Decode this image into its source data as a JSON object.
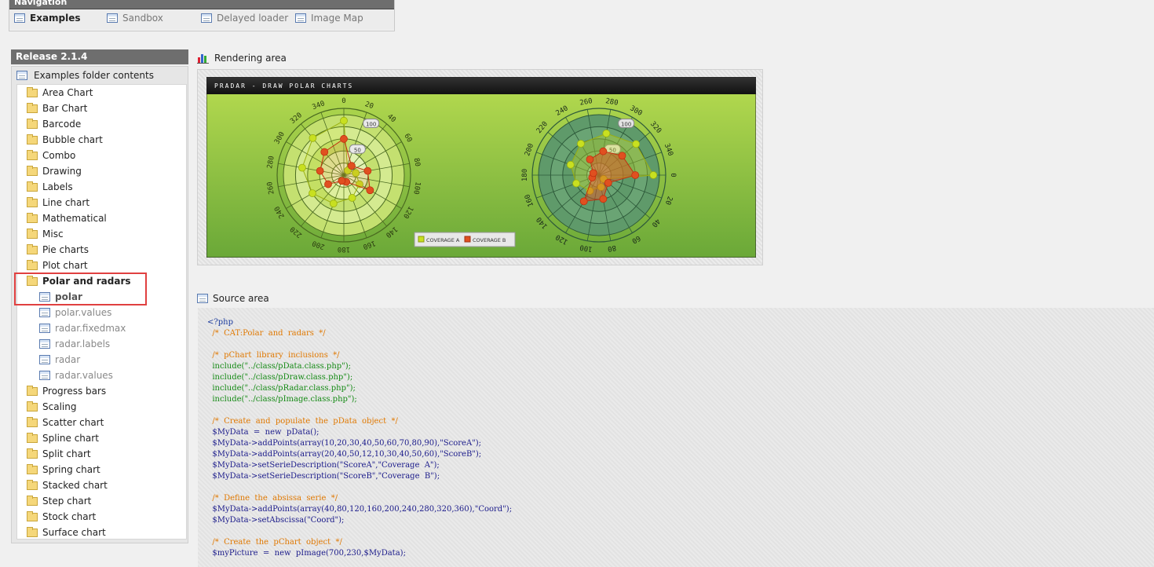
{
  "nav": {
    "title": "Navigation",
    "items": [
      {
        "label": "Examples",
        "icon": "table-icon",
        "active": true
      },
      {
        "label": "Sandbox",
        "icon": "table-icon"
      },
      {
        "label": "Delayed loader",
        "icon": "table-icon"
      },
      {
        "label": "Image Map",
        "icon": "table-icon"
      }
    ]
  },
  "release": "Release 2.1.4",
  "folder_header": "Examples folder contents",
  "tree": {
    "folders_top": [
      "Area Chart",
      "Bar Chart",
      "Barcode",
      "Bubble chart",
      "Combo",
      "Drawing",
      "Labels",
      "Line chart",
      "Mathematical",
      "Misc",
      "Pie charts",
      "Plot chart"
    ],
    "open_folder": "Polar and radars",
    "open_children": [
      "polar",
      "polar.values",
      "radar.fixedmax",
      "radar.labels",
      "radar",
      "radar.values"
    ],
    "selected_child": "polar",
    "folders_bottom": [
      "Progress bars",
      "Scaling",
      "Scatter chart",
      "Spline chart",
      "Split chart",
      "Spring chart",
      "Stacked chart",
      "Step chart",
      "Stock chart",
      "Surface chart"
    ]
  },
  "rendering": {
    "label": "Rendering area",
    "chart_title": "pRadar - Draw polar charts",
    "legend": [
      "Coverage A",
      "Coverage B"
    ],
    "colors": {
      "series_a": "#c8e020",
      "series_b": "#e05020",
      "bg_top": "#b8dc50",
      "bg_bottom": "#6aa838"
    }
  },
  "chart_data": {
    "type": "polar",
    "title": "pRadar - Draw polar charts",
    "series": [
      {
        "name": "Coverage A",
        "values": [
          10,
          20,
          30,
          40,
          50,
          60,
          70,
          80,
          90
        ]
      },
      {
        "name": "Coverage B",
        "values": [
          20,
          40,
          50,
          12,
          10,
          30,
          40,
          50,
          60
        ]
      }
    ],
    "x": [
      40,
      80,
      120,
      160,
      200,
      240,
      280,
      320,
      360
    ],
    "left_axis_labels": [
      "0",
      "20",
      "40",
      "60",
      "80",
      "100",
      "120",
      "140",
      "160",
      "180",
      "200",
      "220",
      "240",
      "260",
      "280",
      "300",
      "320",
      "340"
    ],
    "right_axis_labels": [
      "0",
      "20",
      "40",
      "60",
      "80",
      "100",
      "120",
      "140",
      "160",
      "180",
      "200",
      "220",
      "240",
      "260",
      "280",
      "300",
      "320",
      "340"
    ],
    "scale_labels": [
      "50",
      "100"
    ]
  },
  "source": {
    "label": "Source area",
    "lines": [
      {
        "t": "<?php",
        "c": "php"
      },
      {
        "t": "  /*  CAT:Polar  and  radars  */",
        "c": "comment"
      },
      {
        "t": "",
        "c": "php"
      },
      {
        "t": "  /*  pChart  library  inclusions  */",
        "c": "comment"
      },
      {
        "t": "  include(\"../class/pData.class.php\");",
        "c": "fn"
      },
      {
        "t": "  include(\"../class/pDraw.class.php\");",
        "c": "fn"
      },
      {
        "t": "  include(\"../class/pRadar.class.php\");",
        "c": "fn"
      },
      {
        "t": "  include(\"../class/pImage.class.php\");",
        "c": "fn"
      },
      {
        "t": "",
        "c": "php"
      },
      {
        "t": "  /*  Create  and  populate  the  pData  object  */",
        "c": "comment"
      },
      {
        "t": "  $MyData  =  new  pData();",
        "c": "var"
      },
      {
        "t": "  $MyData->addPoints(array(10,20,30,40,50,60,70,80,90),\"ScoreA\");",
        "c": "var"
      },
      {
        "t": "  $MyData->addPoints(array(20,40,50,12,10,30,40,50,60),\"ScoreB\");",
        "c": "var"
      },
      {
        "t": "  $MyData->setSerieDescription(\"ScoreA\",\"Coverage  A\");",
        "c": "var"
      },
      {
        "t": "  $MyData->setSerieDescription(\"ScoreB\",\"Coverage  B\");",
        "c": "var"
      },
      {
        "t": "",
        "c": "php"
      },
      {
        "t": "  /*  Define  the  absissa  serie  */",
        "c": "comment"
      },
      {
        "t": "  $MyData->addPoints(array(40,80,120,160,200,240,280,320,360),\"Coord\");",
        "c": "var"
      },
      {
        "t": "  $MyData->setAbscissa(\"Coord\");",
        "c": "var"
      },
      {
        "t": "",
        "c": "php"
      },
      {
        "t": "  /*  Create  the  pChart  object  */",
        "c": "comment"
      },
      {
        "t": "  $myPicture  =  new  pImage(700,230,$MyData);",
        "c": "var"
      }
    ]
  }
}
